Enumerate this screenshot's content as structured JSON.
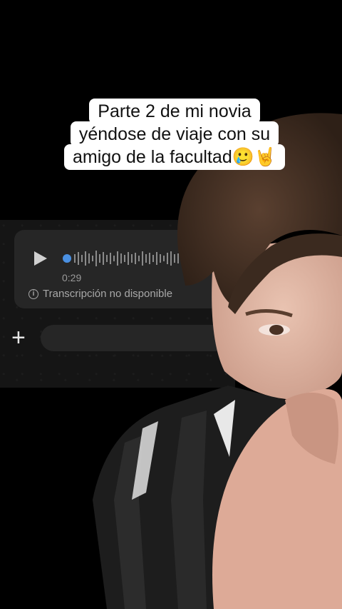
{
  "caption": {
    "line1": "Parte 2 de mi novia",
    "line2": "yéndose de viaje con su",
    "line3": "amigo de la facultad🥲🤘"
  },
  "voice_message": {
    "duration": "0:29",
    "transcription_status": "Transcripción no disponible"
  },
  "composer": {
    "plus_icon": "+"
  },
  "colors": {
    "waveform_progress": "#4a90e2",
    "bubble": "#262626",
    "background": "#000000"
  }
}
